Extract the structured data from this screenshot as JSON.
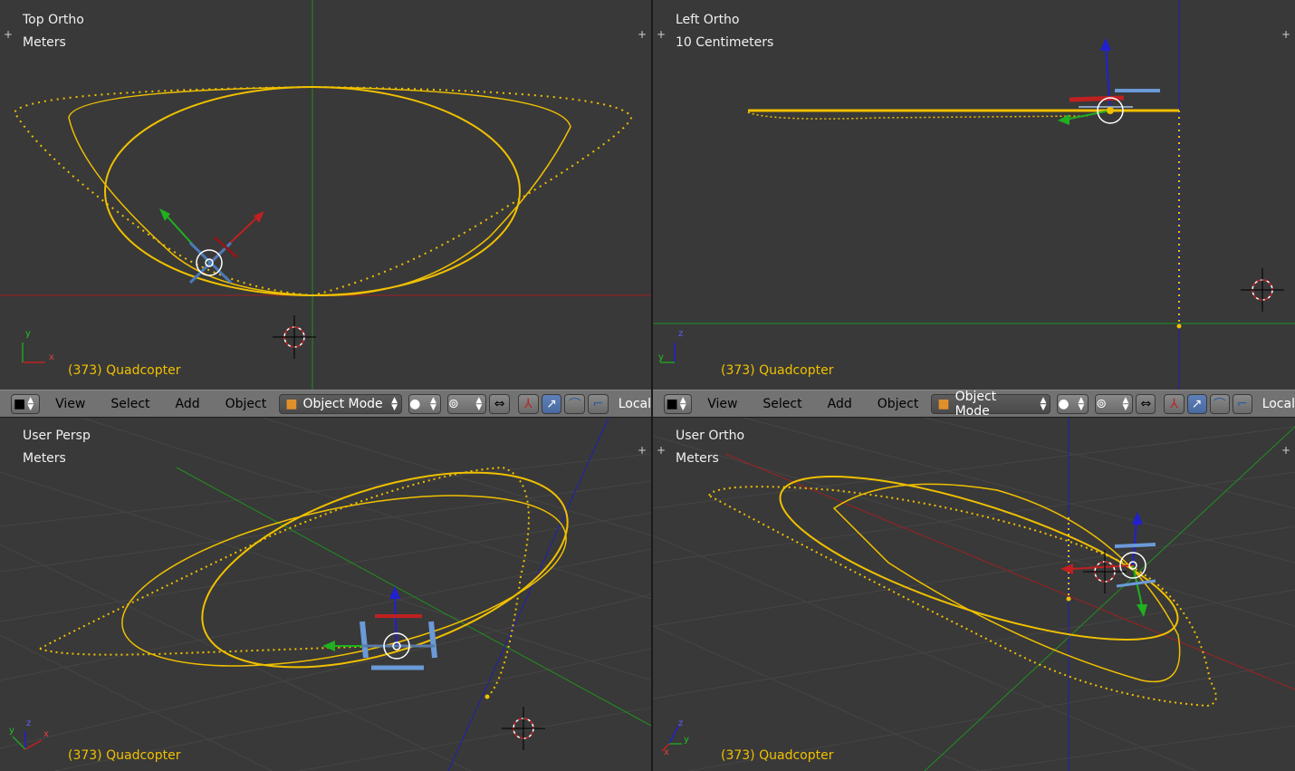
{
  "viewports": [
    {
      "id": "top",
      "title": "Top Ortho",
      "scale": "Meters",
      "object": "(373) Quadcopter",
      "axes": [
        "y",
        "x"
      ]
    },
    {
      "id": "left",
      "title": "Left Ortho",
      "scale": "10 Centimeters",
      "object": "(373) Quadcopter",
      "axes": [
        "z",
        "y"
      ]
    },
    {
      "id": "persp",
      "title": "User Persp",
      "scale": "Meters",
      "object": "(373) Quadcopter",
      "axes": [
        "z",
        "y",
        "x"
      ]
    },
    {
      "id": "ortho",
      "title": "User Ortho",
      "scale": "Meters",
      "object": "(373) Quadcopter",
      "axes": [
        "z",
        "y",
        "x"
      ]
    }
  ],
  "header": {
    "menus": [
      "View",
      "Select",
      "Add",
      "Object"
    ],
    "mode": "Object Mode",
    "orientation": "Local"
  },
  "colors": {
    "background": "#393939",
    "path": "#f0c000",
    "x_axis": "#c02020",
    "y_axis": "#20a020",
    "z_axis": "#2020c0",
    "header": "#727272"
  },
  "icons": [
    "cube-icon",
    "sphere-shading-icon",
    "pivot-icon",
    "snap-icon",
    "manipulator-icon",
    "translate-icon",
    "rotate-icon",
    "scale-icon",
    "cursor-3d-icon"
  ]
}
